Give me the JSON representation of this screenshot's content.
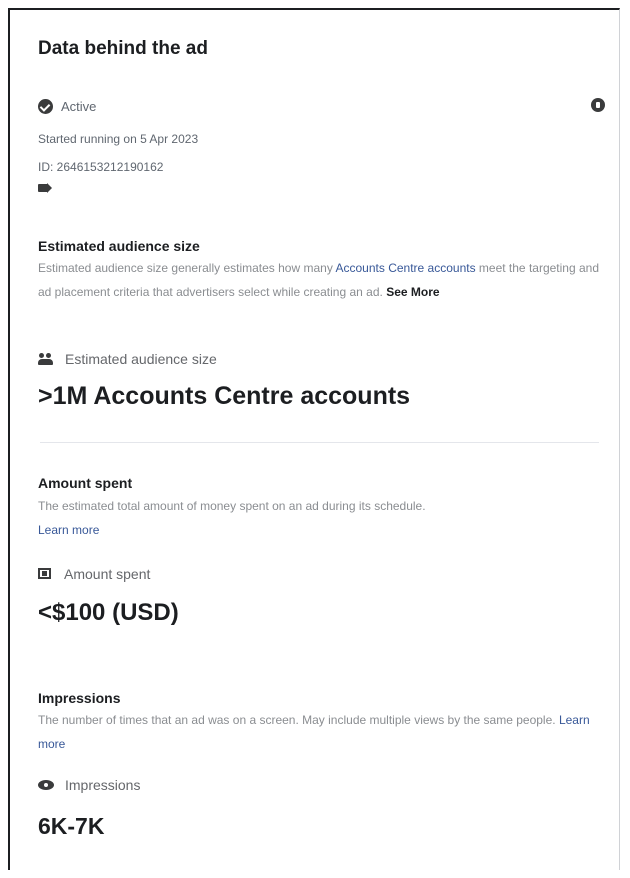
{
  "title": "Data behind the ad",
  "status": {
    "label": "Active",
    "started": "Started running on 5 Apr 2023",
    "id": "ID: 264615321219016​2"
  },
  "audience": {
    "heading": "Estimated audience size",
    "desc_prefix": "Estimated audience size generally estimates how many ",
    "desc_link": "Accounts Centre accounts",
    "desc_suffix": " meet the targeting and ad placement criteria that advertisers select while creating an ad. ",
    "see_more": "See More",
    "metric_label": "Estimated audience size",
    "metric_value": ">1M Accounts Centre accounts"
  },
  "amount": {
    "heading": "Amount spent",
    "desc": "The estimated total amount of money spent on an ad during its schedule.",
    "learn_more": "Learn more",
    "metric_label": "Amount spent",
    "metric_value": "<$100 (USD)"
  },
  "impressions": {
    "heading": "Impressions",
    "desc": "The number of times that an ad was on a screen. May include multiple views by the same people.",
    "learn_more": "Learn more",
    "metric_label": "Impressions",
    "metric_value": "6K-7K"
  },
  "icons": {
    "status": "check-circle-icon",
    "info": "info-icon",
    "platform": "megaphone-icon",
    "audience": "people-icon",
    "amount": "cash-icon",
    "impressions": "eye-icon"
  }
}
